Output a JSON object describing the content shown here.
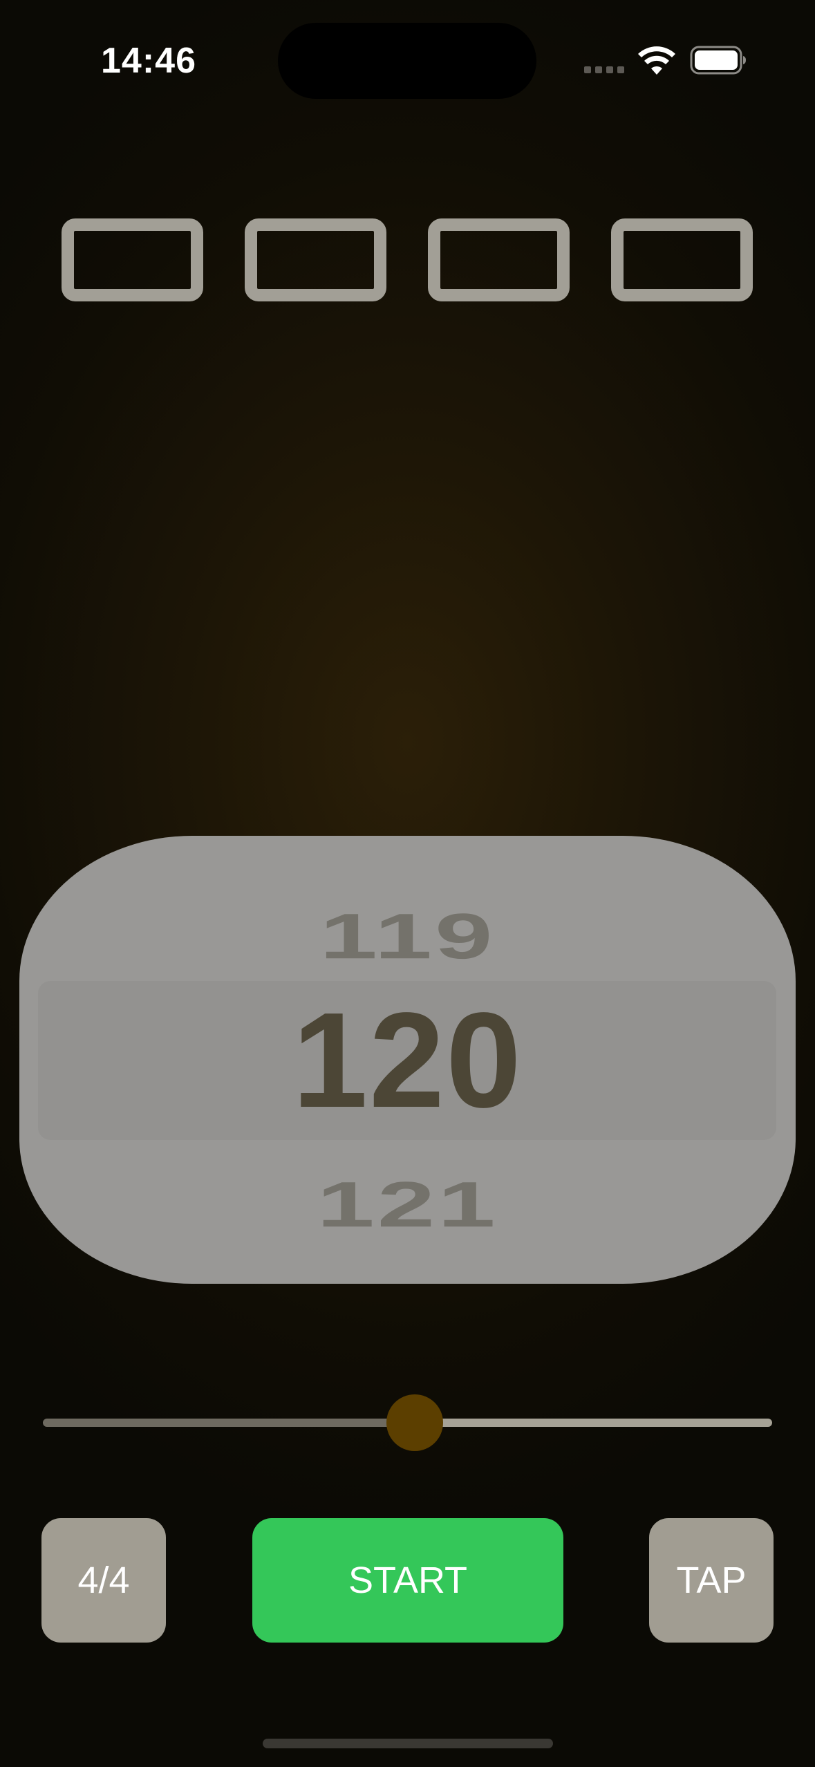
{
  "status_bar": {
    "time": "14:46",
    "icons": [
      "cellular-signal-icon",
      "wifi-icon",
      "battery-icon"
    ]
  },
  "beats": {
    "count": 4,
    "color": "#a29f96"
  },
  "tempo_picker": {
    "previous": "119",
    "current": "120",
    "next": "121"
  },
  "slider": {
    "value_fraction": 0.51,
    "filled_color": "#6e6a60",
    "empty_color": "#a6a296",
    "thumb_color": "#5c3f00"
  },
  "buttons": {
    "time_signature": "4/4",
    "start": "START",
    "tap": "TAP"
  },
  "colors": {
    "start_green": "#34c759",
    "secondary_button": "#a19d92",
    "picker_background": "#999896"
  }
}
